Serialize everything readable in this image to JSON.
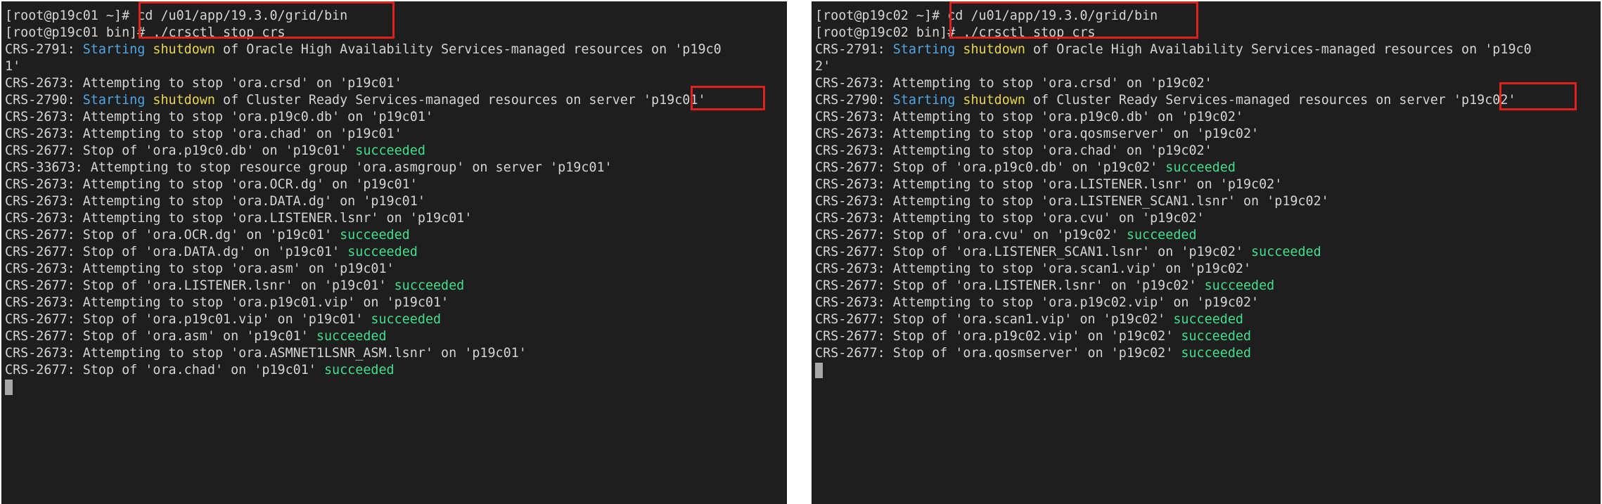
{
  "colors": {
    "background": "#1e1e1e",
    "text": "#d4d4d4",
    "starting": "#4ea8e6",
    "shutdown": "#e9d54a",
    "success": "#3fe08c",
    "highlight_box": "#e0201b"
  },
  "terminals": [
    {
      "host": "p19c01",
      "lines": [
        [
          {
            "t": "[root@p19c01 ~]# cd /u01/app/19.3.0/grid/bin"
          }
        ],
        [
          {
            "t": "[root@p19c01 bin]# ./crsctl stop crs"
          }
        ],
        [
          {
            "t": "CRS-2791: "
          },
          {
            "t": "Starting",
            "c": "s-starting"
          },
          {
            "t": " "
          },
          {
            "t": "shutdown",
            "c": "s-shutdown"
          },
          {
            "t": " of Oracle High Availability Services-managed resources on 'p19c0"
          }
        ],
        [
          {
            "t": "1'"
          }
        ],
        [
          {
            "t": "CRS-2673: Attempting to stop 'ora.crsd' on 'p19c01'"
          }
        ],
        [
          {
            "t": "CRS-2790: "
          },
          {
            "t": "Starting",
            "c": "s-starting"
          },
          {
            "t": " "
          },
          {
            "t": "shutdown",
            "c": "s-shutdown"
          },
          {
            "t": " of Cluster Ready Services-managed resources on server 'p19c01'"
          }
        ],
        [
          {
            "t": "CRS-2673: Attempting to stop 'ora.p19c0.db' on 'p19c01'"
          }
        ],
        [
          {
            "t": "CRS-2673: Attempting to stop 'ora.chad' on 'p19c01'"
          }
        ],
        [
          {
            "t": "CRS-2677: Stop of 'ora.p19c0.db' on 'p19c01' "
          },
          {
            "t": "succeeded",
            "c": "s-success"
          }
        ],
        [
          {
            "t": "CRS-33673: Attempting to stop resource group 'ora.asmgroup' on server 'p19c01'"
          }
        ],
        [
          {
            "t": "CRS-2673: Attempting to stop 'ora.OCR.dg' on 'p19c01'"
          }
        ],
        [
          {
            "t": "CRS-2673: Attempting to stop 'ora.DATA.dg' on 'p19c01'"
          }
        ],
        [
          {
            "t": "CRS-2673: Attempting to stop 'ora.LISTENER.lsnr' on 'p19c01'"
          }
        ],
        [
          {
            "t": "CRS-2677: Stop of 'ora.OCR.dg' on 'p19c01' "
          },
          {
            "t": "succeeded",
            "c": "s-success"
          }
        ],
        [
          {
            "t": "CRS-2677: Stop of 'ora.DATA.dg' on 'p19c01' "
          },
          {
            "t": "succeeded",
            "c": "s-success"
          }
        ],
        [
          {
            "t": "CRS-2673: Attempting to stop 'ora.asm' on 'p19c01'"
          }
        ],
        [
          {
            "t": "CRS-2677: Stop of 'ora.LISTENER.lsnr' on 'p19c01' "
          },
          {
            "t": "succeeded",
            "c": "s-success"
          }
        ],
        [
          {
            "t": "CRS-2673: Attempting to stop 'ora.p19c01.vip' on 'p19c01'"
          }
        ],
        [
          {
            "t": "CRS-2677: Stop of 'ora.p19c01.vip' on 'p19c01' "
          },
          {
            "t": "succeeded",
            "c": "s-success"
          }
        ],
        [
          {
            "t": "CRS-2677: Stop of 'ora.asm' on 'p19c01' "
          },
          {
            "t": "succeeded",
            "c": "s-success"
          }
        ],
        [
          {
            "t": "CRS-2673: Attempting to stop 'ora.ASMNET1LSNR_ASM.lsnr' on 'p19c01'"
          }
        ],
        [
          {
            "t": "CRS-2677: Stop of 'ora.chad' on 'p19c01' "
          },
          {
            "t": "succeeded",
            "c": "s-success"
          }
        ]
      ]
    },
    {
      "host": "p19c02",
      "lines": [
        [
          {
            "t": "[root@p19c02 ~]# cd /u01/app/19.3.0/grid/bin"
          }
        ],
        [
          {
            "t": "[root@p19c02 bin]# ./crsctl stop crs"
          }
        ],
        [
          {
            "t": "CRS-2791: "
          },
          {
            "t": "Starting",
            "c": "s-starting"
          },
          {
            "t": " "
          },
          {
            "t": "shutdown",
            "c": "s-shutdown"
          },
          {
            "t": " of Oracle High Availability Services-managed resources on 'p19c0"
          }
        ],
        [
          {
            "t": "2'"
          }
        ],
        [
          {
            "t": "CRS-2673: Attempting to stop 'ora.crsd' on 'p19c02'"
          }
        ],
        [
          {
            "t": "CRS-2790: "
          },
          {
            "t": "Starting",
            "c": "s-starting"
          },
          {
            "t": " "
          },
          {
            "t": "shutdown",
            "c": "s-shutdown"
          },
          {
            "t": " of Cluster Ready Services-managed resources on server 'p19c02'"
          }
        ],
        [
          {
            "t": "CRS-2673: Attempting to stop 'ora.p19c0.db' on 'p19c02'"
          }
        ],
        [
          {
            "t": "CRS-2673: Attempting to stop 'ora.qosmserver' on 'p19c02'"
          }
        ],
        [
          {
            "t": "CRS-2673: Attempting to stop 'ora.chad' on 'p19c02'"
          }
        ],
        [
          {
            "t": "CRS-2677: Stop of 'ora.p19c0.db' on 'p19c02' "
          },
          {
            "t": "succeeded",
            "c": "s-success"
          }
        ],
        [
          {
            "t": "CRS-2673: Attempting to stop 'ora.LISTENER.lsnr' on 'p19c02'"
          }
        ],
        [
          {
            "t": "CRS-2673: Attempting to stop 'ora.LISTENER_SCAN1.lsnr' on 'p19c02'"
          }
        ],
        [
          {
            "t": "CRS-2673: Attempting to stop 'ora.cvu' on 'p19c02'"
          }
        ],
        [
          {
            "t": "CRS-2677: Stop of 'ora.cvu' on 'p19c02' "
          },
          {
            "t": "succeeded",
            "c": "s-success"
          }
        ],
        [
          {
            "t": "CRS-2677: Stop of 'ora.LISTENER_SCAN1.lsnr' on 'p19c02' "
          },
          {
            "t": "succeeded",
            "c": "s-success"
          }
        ],
        [
          {
            "t": "CRS-2673: Attempting to stop 'ora.scan1.vip' on 'p19c02'"
          }
        ],
        [
          {
            "t": "CRS-2677: Stop of 'ora.LISTENER.lsnr' on 'p19c02' "
          },
          {
            "t": "succeeded",
            "c": "s-success"
          }
        ],
        [
          {
            "t": "CRS-2673: Attempting to stop 'ora.p19c02.vip' on 'p19c02'"
          }
        ],
        [
          {
            "t": "CRS-2677: Stop of 'ora.scan1.vip' on 'p19c02' "
          },
          {
            "t": "succeeded",
            "c": "s-success"
          }
        ],
        [
          {
            "t": "CRS-2677: Stop of 'ora.p19c02.vip' on 'p19c02' "
          },
          {
            "t": "succeeded",
            "c": "s-success"
          }
        ],
        [
          {
            "t": "CRS-2677: Stop of 'ora.qosmserver' on 'p19c02' "
          },
          {
            "t": "succeeded",
            "c": "s-success"
          }
        ]
      ]
    }
  ]
}
